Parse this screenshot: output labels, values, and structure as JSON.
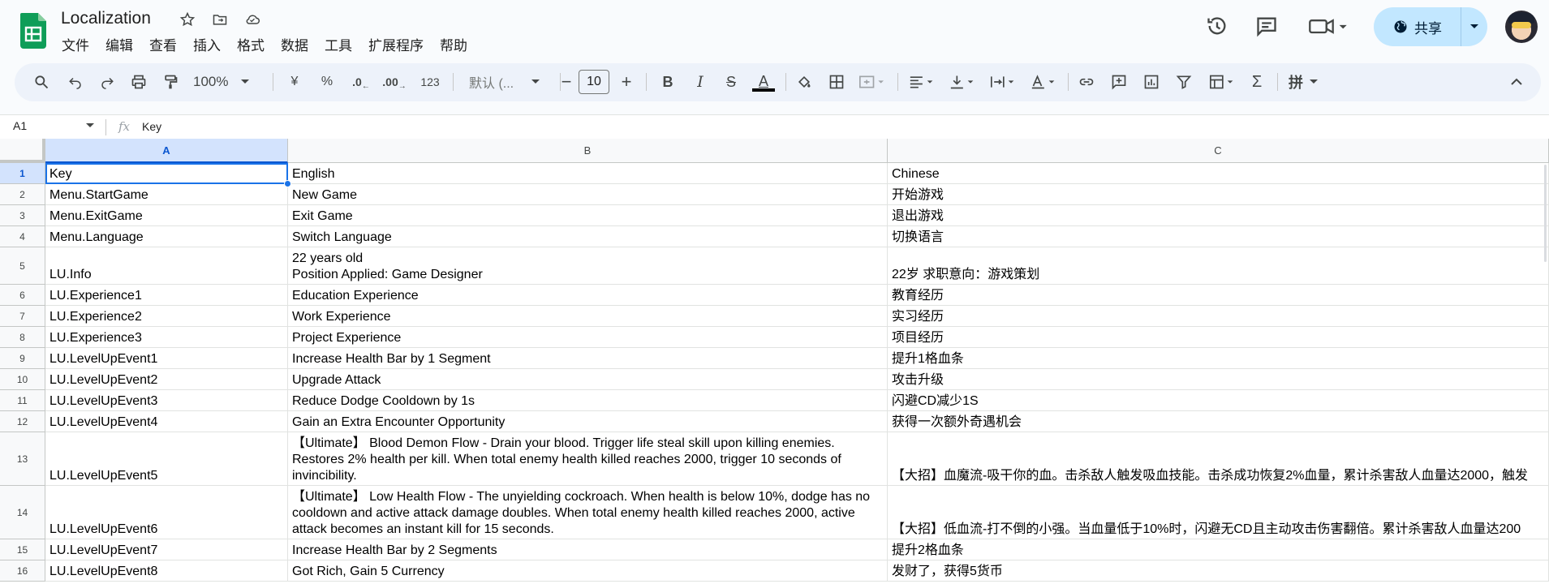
{
  "app": {
    "title": "Localization",
    "menu": [
      "文件",
      "编辑",
      "查看",
      "插入",
      "格式",
      "数据",
      "工具",
      "扩展程序",
      "帮助"
    ],
    "share_label": "共享",
    "accent": "#1a73e8",
    "share_bg": "#c2e7ff"
  },
  "toolbar": {
    "zoom": "100%",
    "currency": "¥",
    "percent": "%",
    "dec_decrease": ".0",
    "dec_increase": ".00",
    "number_format": "123",
    "font": "默认 (...",
    "font_size": "10",
    "minus": "−",
    "plus": "+",
    "bold": "B",
    "italic": "I",
    "strike": "S",
    "text_color": "A",
    "sigma": "Σ",
    "pinyin": "拼"
  },
  "formula_bar": {
    "cell_ref": "A1",
    "fx": "fx",
    "value": "Key"
  },
  "columns": [
    "A",
    "B",
    "C"
  ],
  "rows": [
    {
      "num": "1",
      "a": "Key",
      "b": "English",
      "c": "Chinese"
    },
    {
      "num": "2",
      "a": "Menu.StartGame",
      "b": "New Game",
      "c": "开始游戏"
    },
    {
      "num": "3",
      "a": "Menu.ExitGame",
      "b": "Exit Game",
      "c": "退出游戏"
    },
    {
      "num": "4",
      "a": "Menu.Language",
      "b": "Switch Language",
      "c": "切换语言"
    },
    {
      "num": "5",
      "a": "LU.Info",
      "b": "22 years old\nPosition Applied: Game Designer",
      "c": "22岁\n求职意向：游戏策划"
    },
    {
      "num": "6",
      "a": "LU.Experience1",
      "b": "Education Experience",
      "c": "教育经历"
    },
    {
      "num": "7",
      "a": "LU.Experience2",
      "b": "Work Experience",
      "c": "实习经历"
    },
    {
      "num": "8",
      "a": "LU.Experience3",
      "b": "Project Experience",
      "c": "项目经历"
    },
    {
      "num": "9",
      "a": "LU.LevelUpEvent1",
      "b": "Increase Health Bar by 1 Segment",
      "c": "提升1格血条"
    },
    {
      "num": "10",
      "a": "LU.LevelUpEvent2",
      "b": "Upgrade Attack",
      "c": "攻击升级"
    },
    {
      "num": "11",
      "a": "LU.LevelUpEvent3",
      "b": "Reduce Dodge Cooldown by 1s",
      "c": "闪避CD减少1S"
    },
    {
      "num": "12",
      "a": "LU.LevelUpEvent4",
      "b": "Gain an Extra Encounter Opportunity",
      "c": "获得一次额外奇遇机会"
    },
    {
      "num": "13",
      "a": "LU.LevelUpEvent5",
      "b": "【Ultimate】 Blood Demon Flow - Drain your blood. Trigger life steal skill upon killing enemies. Restores 2% health per kill. When total enemy health killed reaches 2000, trigger 10 seconds of invincibility.",
      "c": "【大招】血魔流-吸干你的血。击杀敌人触发吸血技能。击杀成功恢复2%血量，累计杀害敌人血量达2000，触发"
    },
    {
      "num": "14",
      "a": "LU.LevelUpEvent6",
      "b": "【Ultimate】 Low Health Flow - The unyielding cockroach. When health is below 10%, dodge has no cooldown and active attack damage doubles. When total enemy health killed reaches 2000, active attack becomes an instant kill for 15 seconds.",
      "c": "【大招】低血流-打不倒的小强。当血量低于10%时，闪避无CD且主动攻击伤害翻倍。累计杀害敌人血量达200"
    },
    {
      "num": "15",
      "a": "LU.LevelUpEvent7",
      "b": "Increase Health Bar by 2 Segments",
      "c": "提升2格血条"
    },
    {
      "num": "16",
      "a": "LU.LevelUpEvent8",
      "b": "Got Rich, Gain 5 Currency",
      "c": "发财了，获得5货币"
    }
  ]
}
